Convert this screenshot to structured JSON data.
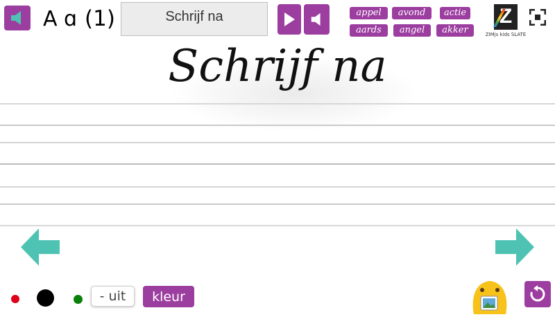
{
  "header": {
    "lesson_letters": "A ɑ",
    "lesson_number": "(1)",
    "exercise_title": "Schrijf na",
    "words_row1": [
      "appel",
      "avond",
      "actie"
    ],
    "words_row2": [
      "aards",
      "angel",
      "akker"
    ],
    "logo_letter": "Z",
    "logo_caption": "ZIMjs kids SLATE"
  },
  "main": {
    "writing_text": "Schrijf na"
  },
  "footer": {
    "uit_label": "- uit",
    "kleur_label": "kleur"
  },
  "colors": {
    "accent": "#9c3da0",
    "arrow": "#4ec3b3",
    "pen_red": "#e0001a",
    "pen_black": "#000000",
    "pen_green": "#0a7f0a"
  }
}
